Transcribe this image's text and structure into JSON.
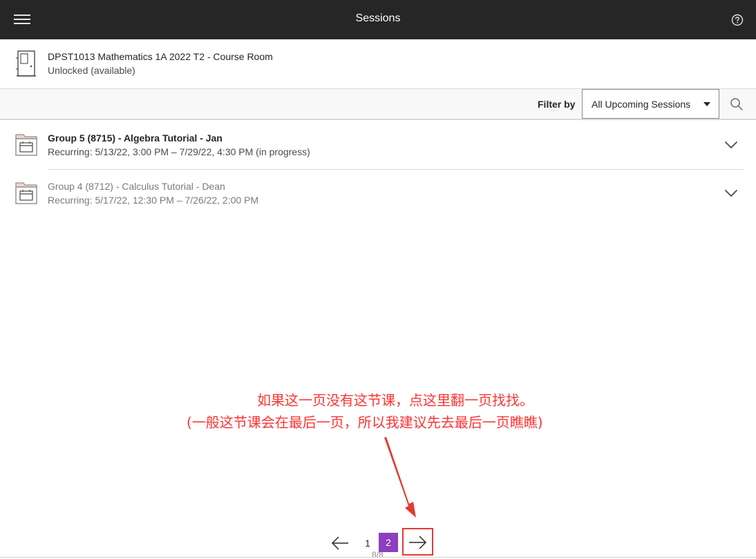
{
  "topbar": {
    "title": "Sessions",
    "menu_icon": "hamburger-menu-icon",
    "help_icon": "help-question-icon"
  },
  "course": {
    "title": "DPST1013 Mathematics 1A 2022 T2 - Course Room",
    "status": "Unlocked (available)",
    "icon": "door-icon"
  },
  "filter": {
    "label": "Filter by",
    "selected": "All Upcoming Sessions",
    "search_icon": "search-icon"
  },
  "sessions": [
    {
      "title": "Group 5 (8715) - Algebra Tutorial - Jan",
      "time": "Recurring: 5/13/22, 3:00 PM – 7/29/22, 4:30 PM (in progress)",
      "icon": "calendar-icon"
    },
    {
      "title": "Group 4 (8712) - Calculus Tutorial - Dean",
      "time": "Recurring: 5/17/22, 12:30 PM – 7/26/22, 2:00 PM",
      "icon": "calendar-icon"
    }
  ],
  "annotation": {
    "line1": "如果这一页没有这节课，点这里翻一页找找。",
    "line2": "(一般这节课会在最后一页，所以我建议先去最后一页瞧瞧)",
    "color": "#ff3333"
  },
  "pagination": {
    "pages": [
      "1",
      "2"
    ],
    "current": "2",
    "count": "8/8",
    "accent": "#8c3fbf"
  }
}
